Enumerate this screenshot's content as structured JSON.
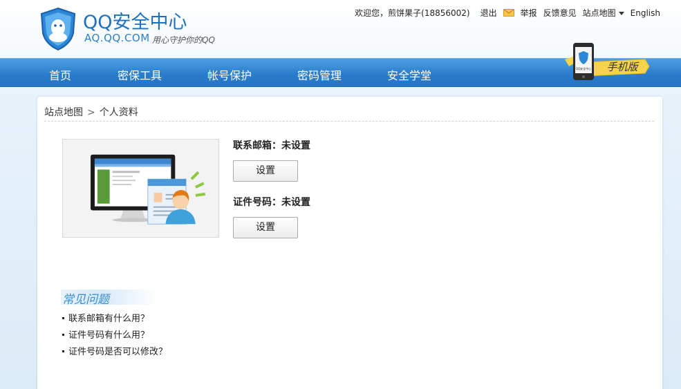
{
  "header": {
    "logo_title": "QQ安全中心",
    "logo_domain": "AQ.QQ.COM",
    "logo_slogan": "用心守护你的QQ",
    "welcome": "欢迎您，煎饼果子(18856002)",
    "logout": "退出",
    "report": "举报",
    "feedback": "反馈意见",
    "sitemap": "站点地图",
    "english": "English"
  },
  "nav": {
    "items": [
      "首页",
      "密保工具",
      "帐号保护",
      "密码管理",
      "安全学堂"
    ],
    "mobile_label": "手机版",
    "phone_caption": "QQ安全中心"
  },
  "breadcrumb": {
    "root": "站点地图",
    "separator": ">",
    "current": "个人资料"
  },
  "profile": {
    "email_label": "联系邮箱：未设置",
    "email_button": "设置",
    "id_label": "证件号码：未设置",
    "id_button": "设置"
  },
  "faq": {
    "title": "常见问题",
    "items": [
      "联系邮箱有什么用？",
      "证件号码有什么用？",
      "证件号码是否可以修改？"
    ]
  },
  "colors": {
    "nav_blue": "#2a7dcc",
    "brand_blue": "#1d6fbf",
    "faq_blue": "#3d8fd0",
    "badge_yellow": "#f5d34a"
  },
  "icons": [
    "qq-shield-logo-icon",
    "mail-icon",
    "chevron-down-icon",
    "mobile-phone-icon"
  ]
}
